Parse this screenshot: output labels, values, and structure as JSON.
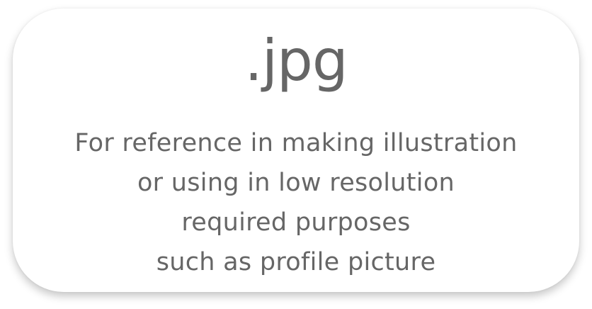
{
  "card": {
    "title": ".jpg",
    "description_lines": [
      "For reference in making illustration",
      "or using in low resolution",
      "required purposes",
      "such as profile picture"
    ]
  },
  "colors": {
    "text": "#666666",
    "background": "#ffffff"
  }
}
